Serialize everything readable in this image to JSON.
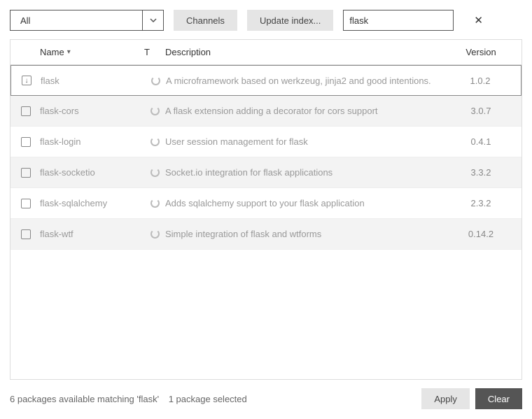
{
  "toolbar": {
    "filter_selected": "All",
    "channels_label": "Channels",
    "update_index_label": "Update index...",
    "search_value": "flask"
  },
  "columns": {
    "name": "Name",
    "t": "T",
    "description": "Description",
    "version": "Version"
  },
  "packages": [
    {
      "status": "install",
      "name": "flask",
      "description": "A microframework based on werkzeug, jinja2 and good intentions.",
      "version": "1.0.2",
      "selected": true
    },
    {
      "status": "unchecked",
      "name": "flask-cors",
      "description": "A flask extension adding a decorator for cors support",
      "version": "3.0.7",
      "selected": false
    },
    {
      "status": "unchecked",
      "name": "flask-login",
      "description": "User session management for flask",
      "version": "0.4.1",
      "selected": false
    },
    {
      "status": "unchecked",
      "name": "flask-socketio",
      "description": "Socket.io integration for flask applications",
      "version": "3.3.2",
      "selected": false
    },
    {
      "status": "unchecked",
      "name": "flask-sqlalchemy",
      "description": "Adds sqlalchemy support to your flask application",
      "version": "2.3.2",
      "selected": false
    },
    {
      "status": "unchecked",
      "name": "flask-wtf",
      "description": "Simple integration of flask and wtforms",
      "version": "0.14.2",
      "selected": false
    }
  ],
  "footer": {
    "status_text": "6 packages available matching 'flask'",
    "selected_text": "1 package selected",
    "apply_label": "Apply",
    "clear_label": "Clear"
  }
}
